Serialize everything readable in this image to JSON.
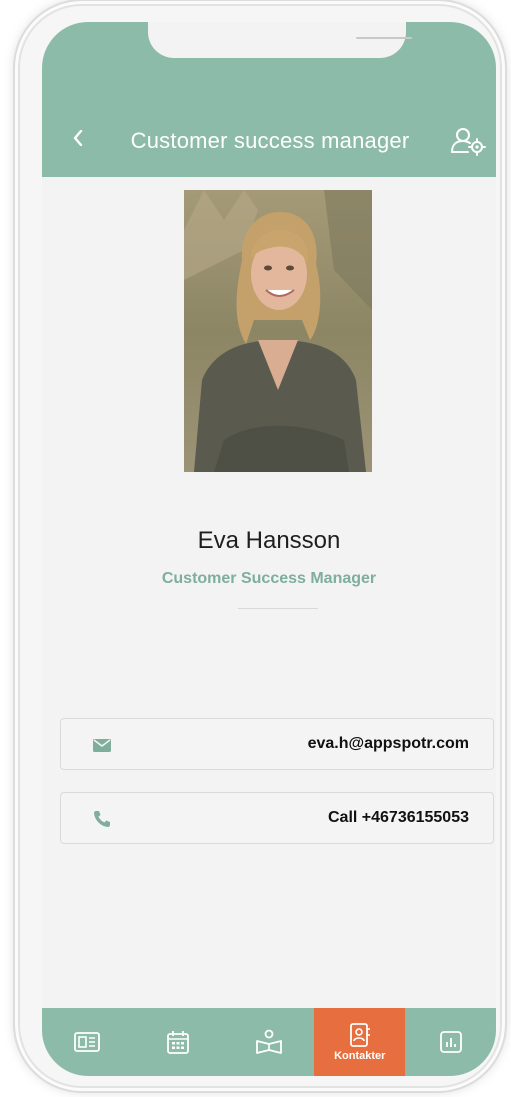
{
  "header": {
    "title": "Customer success manager",
    "back_icon": "chevron-left-icon",
    "settings_icon": "user-settings-icon"
  },
  "profile": {
    "name": "Eva Hansson",
    "role": "Customer Success Manager"
  },
  "contacts": [
    {
      "icon": "envelope-icon",
      "value": "eva.h@appspotr.com"
    },
    {
      "icon": "phone-icon",
      "value": "Call +46736155053"
    }
  ],
  "tabbar": {
    "items": [
      {
        "icon": "news-icon",
        "label": ""
      },
      {
        "icon": "calendar-icon",
        "label": ""
      },
      {
        "icon": "reading-icon",
        "label": ""
      },
      {
        "icon": "contact-book-icon",
        "label": "Kontakter",
        "active": true
      },
      {
        "icon": "chart-icon",
        "label": ""
      }
    ]
  },
  "colors": {
    "brand": "#8dbba9",
    "accent": "#e76f3f",
    "role_text": "#7fae9c"
  }
}
